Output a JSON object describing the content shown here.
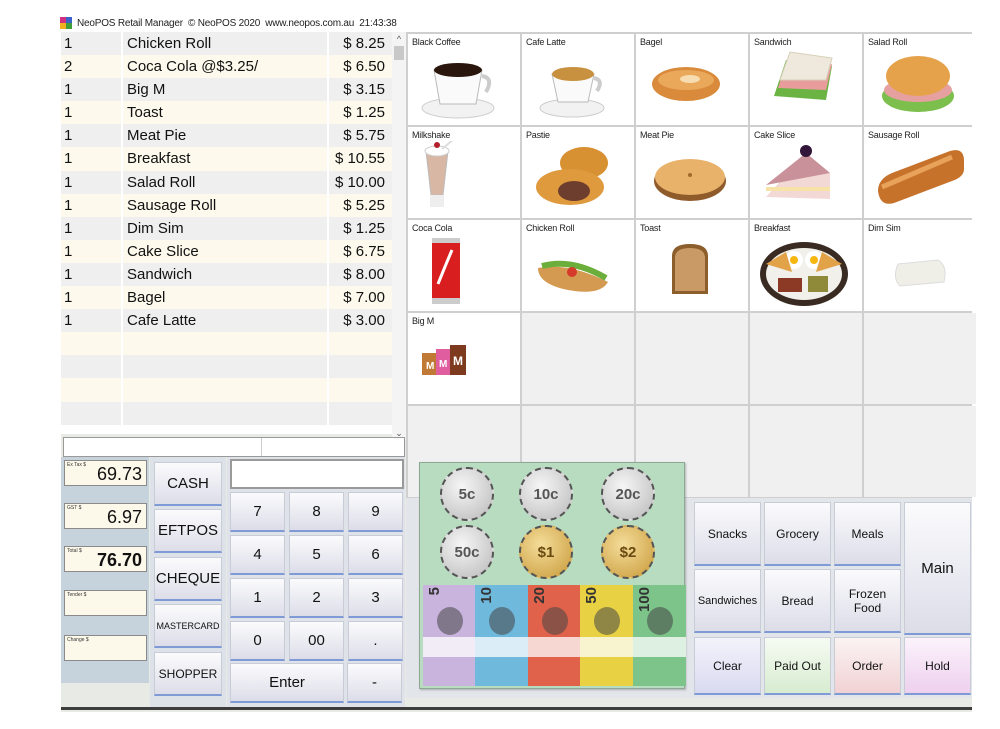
{
  "titlebar": {
    "app_name": "NeoPOS Retail Manager",
    "copyright": "© NeoPOS 2020",
    "website": "www.neopos.com.au",
    "time": "21:43:38"
  },
  "order": {
    "items": [
      {
        "qty": "1",
        "name": "Chicken Roll",
        "price": "$ 8.25"
      },
      {
        "qty": "2",
        "name": "Coca Cola @$3.25/",
        "price": "$ 6.50"
      },
      {
        "qty": "1",
        "name": "Big M",
        "price": "$ 3.15"
      },
      {
        "qty": "1",
        "name": "Toast",
        "price": "$ 1.25"
      },
      {
        "qty": "1",
        "name": "Meat Pie",
        "price": "$ 5.75"
      },
      {
        "qty": "1",
        "name": "Breakfast",
        "price": "$ 10.55"
      },
      {
        "qty": "1",
        "name": "Salad Roll",
        "price": "$ 10.00"
      },
      {
        "qty": "1",
        "name": "Sausage Roll",
        "price": "$ 5.25"
      },
      {
        "qty": "1",
        "name": "Dim Sim",
        "price": "$ 1.25"
      },
      {
        "qty": "1",
        "name": "Cake Slice",
        "price": "$ 6.75"
      },
      {
        "qty": "1",
        "name": "Sandwich",
        "price": "$ 8.00"
      },
      {
        "qty": "1",
        "name": "Bagel",
        "price": "$ 7.00"
      },
      {
        "qty": "1",
        "name": "Cafe Latte",
        "price": "$ 3.00"
      }
    ],
    "empty_rows": 4
  },
  "totals": {
    "ex_tax": {
      "label": "Ex Tax $",
      "value": "69.73"
    },
    "gst": {
      "label": "GST $",
      "value": "6.97"
    },
    "total": {
      "label": "Total $",
      "value": "76.70"
    },
    "tender": {
      "label": "Tender $",
      "value": ""
    },
    "change": {
      "label": "Change $",
      "value": ""
    }
  },
  "payment": {
    "cash": "CASH",
    "eftpos": "EFTPOS",
    "cheque": "CHEQUE",
    "mastercard": "MASTERCARD",
    "shopper": "SHOPPER"
  },
  "keypad": {
    "display": "",
    "keys": [
      "7",
      "8",
      "9",
      "4",
      "5",
      "6",
      "1",
      "2",
      "3",
      "0",
      "00",
      "."
    ],
    "enter": "Enter",
    "minus": "-"
  },
  "products": [
    {
      "name": "Black Coffee",
      "icon": "coffee-cup"
    },
    {
      "name": "Cafe Latte",
      "icon": "latte-cup"
    },
    {
      "name": "Bagel",
      "icon": "bagel"
    },
    {
      "name": "Sandwich",
      "icon": "sandwich"
    },
    {
      "name": "Salad Roll",
      "icon": "salad-roll"
    },
    {
      "name": "Milkshake",
      "icon": "milkshake"
    },
    {
      "name": "Pastie",
      "icon": "pastie"
    },
    {
      "name": "Meat Pie",
      "icon": "meat-pie"
    },
    {
      "name": "Cake Slice",
      "icon": "cake-slice"
    },
    {
      "name": "Sausage Roll",
      "icon": "sausage-roll"
    },
    {
      "name": "Coca Cola",
      "icon": "cola-can"
    },
    {
      "name": "Chicken Roll",
      "icon": "chicken-roll"
    },
    {
      "name": "Toast",
      "icon": "toast"
    },
    {
      "name": "Breakfast",
      "icon": "breakfast-plate"
    },
    {
      "name": "Dim Sim",
      "icon": "dim-sim"
    },
    {
      "name": "Big M",
      "icon": "milk-cartons"
    }
  ],
  "categories": {
    "snacks": "Snacks",
    "grocery": "Grocery",
    "meals": "Meals",
    "main": "Main",
    "sandwiches": "Sandwiches",
    "bread": "Bread",
    "frozen_food": "Frozen Food",
    "clear": "Clear",
    "paid_out": "Paid Out",
    "order": "Order",
    "hold": "Hold"
  },
  "cash_popup": {
    "coins": [
      {
        "value": "5c",
        "type": "silver"
      },
      {
        "value": "10c",
        "type": "silver"
      },
      {
        "value": "20c",
        "type": "silver"
      },
      {
        "value": "50c",
        "type": "silver"
      },
      {
        "value": "$1",
        "type": "gold"
      },
      {
        "value": "$2",
        "type": "gold"
      }
    ],
    "notes": [
      {
        "value": "5",
        "color": "#c9b4de"
      },
      {
        "value": "10",
        "color": "#6fb9dd"
      },
      {
        "value": "20",
        "color": "#e0624a"
      },
      {
        "value": "50",
        "color": "#e8d243"
      },
      {
        "value": "100",
        "color": "#7cc48a"
      }
    ]
  },
  "colors": {
    "clear_bg": "#dfe0f3",
    "paid_out_bg": "#dcefd6",
    "order_bg": "#f3d6d8",
    "hold_bg": "#f0d6ef",
    "accent_underline": "#7e9bd6"
  }
}
